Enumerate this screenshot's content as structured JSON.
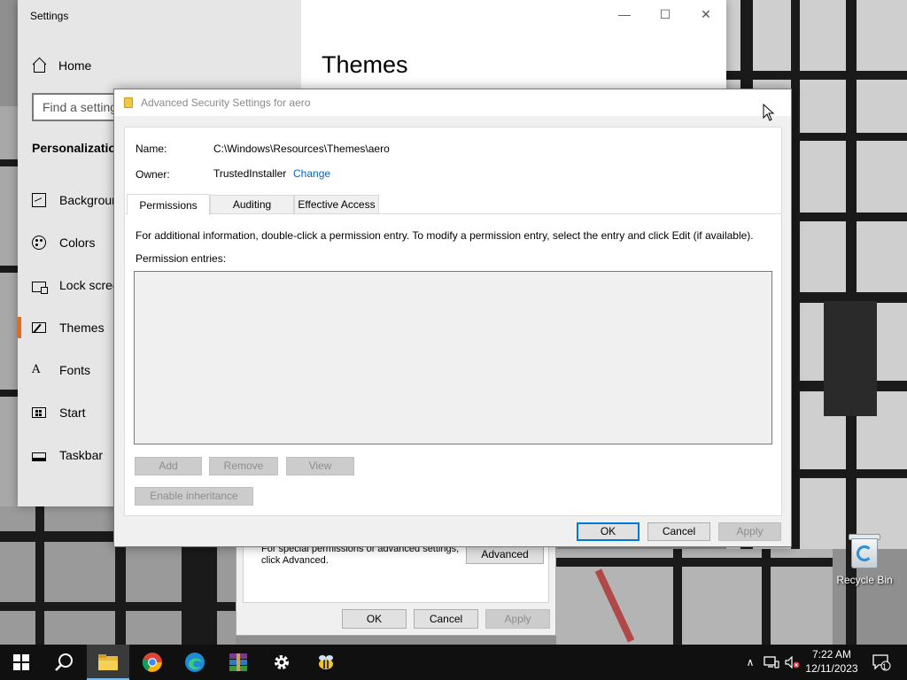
{
  "settings": {
    "title": "Settings",
    "home_label": "Home",
    "search_placeholder": "Find a setting",
    "section_label": "Personalization",
    "nav_items": [
      {
        "label": "Background",
        "icon": "picture-icon"
      },
      {
        "label": "Colors",
        "icon": "palette-icon"
      },
      {
        "label": "Lock screen",
        "icon": "lock-screen-icon"
      },
      {
        "label": "Themes",
        "icon": "themes-icon",
        "active": true
      },
      {
        "label": "Fonts",
        "icon": "fonts-icon"
      },
      {
        "label": "Start",
        "icon": "start-icon"
      },
      {
        "label": "Taskbar",
        "icon": "taskbar-icon"
      }
    ],
    "page_heading": "Themes",
    "controls": {
      "minimize": "—",
      "maximize": "☐",
      "close": "✕"
    }
  },
  "advanced_dialog": {
    "title": "Advanced Security Settings for aero",
    "name_label": "Name:",
    "name_value": "C:\\Windows\\Resources\\Themes\\aero",
    "owner_label": "Owner:",
    "owner_value": "TrustedInstaller",
    "change_link": "Change",
    "tabs": [
      "Permissions",
      "Auditing",
      "Effective Access"
    ],
    "selected_tab": "Permissions",
    "info_text": "For additional information, double-click a permission entry. To modify a permission entry, select the entry and click Edit (if available).",
    "entries_label": "Permission entries:",
    "buttons": {
      "add": "Add",
      "remove": "Remove",
      "view": "View",
      "enable_inheritance": "Enable inheritance",
      "ok": "OK",
      "cancel": "Cancel",
      "apply": "Apply"
    }
  },
  "properties_dialog": {
    "note": "For special permissions or advanced settings, click Advanced.",
    "advanced_button": "Advanced",
    "ok": "OK",
    "cancel": "Cancel",
    "apply": "Apply"
  },
  "desktop": {
    "recycle_bin_label": "Recycle Bin"
  },
  "taskbar": {
    "time": "7:22 AM",
    "date": "12/11/2023",
    "notification_count": "1",
    "items": [
      "start-button",
      "search-button",
      "file-explorer",
      "chrome",
      "edge",
      "winrar",
      "settings",
      "app-bee"
    ],
    "accent": "#76b9ed"
  }
}
